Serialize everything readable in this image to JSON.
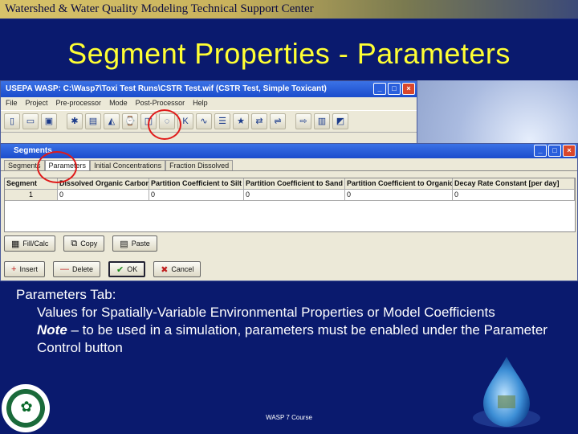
{
  "header": {
    "center_name": "Watershed & Water Quality Modeling Technical Support Center"
  },
  "slide": {
    "title": "Segment Properties - Parameters"
  },
  "app_window": {
    "title": "USEPA WASP: C:\\Wasp7\\Toxi Test Runs\\CSTR Test.wif (CSTR Test, Simple Toxicant)",
    "menu": [
      "File",
      "Project",
      "Pre-processor",
      "Mode",
      "Post-Processor",
      "Help"
    ]
  },
  "segments_window": {
    "title": "Segments",
    "tabs": [
      "Segments",
      "Parameters",
      "Initial Concentrations",
      "Fraction Dissolved"
    ],
    "columns": [
      "Segment",
      "Dissolved Organic Carbon",
      "Partition Coefficient to Silt",
      "Partition Coefficient to Sand",
      "Partition Coefficient to Organic",
      "Decay Rate Constant [per day]"
    ],
    "rows": [
      [
        "1",
        "0",
        "0",
        "0",
        "0",
        "0"
      ]
    ],
    "buttons_row1": [
      "Fill/Calc",
      "Copy",
      "Paste"
    ],
    "buttons_row2": [
      "Insert",
      "Delete",
      "OK",
      "Cancel"
    ]
  },
  "caption": {
    "heading": "Parameters Tab:",
    "line1": "Values for Spatially-Variable Environmental Properties or Model Coefficients",
    "note_label": "Note",
    "note_text": " – to be used in a simulation, parameters must be enabled under the Parameter Control button"
  },
  "footer": {
    "course": "WASP 7 Course"
  },
  "colors": {
    "background": "#0a1a6e",
    "title": "#ffff33",
    "highlight_circle": "#e01a1a"
  }
}
